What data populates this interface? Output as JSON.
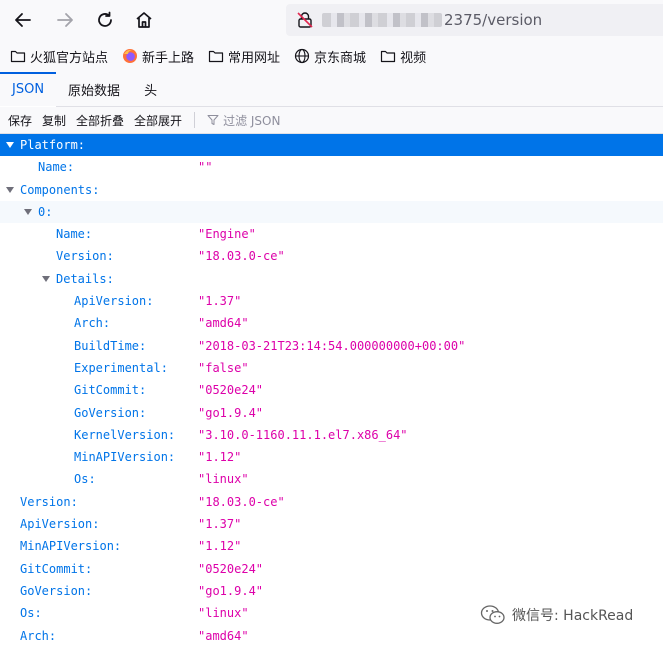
{
  "browser": {
    "url_visible": "2375/version",
    "bookmarks": [
      {
        "label": "火狐官方站点",
        "icon": "folder-icon"
      },
      {
        "label": "新手上路",
        "icon": "firefox-icon"
      },
      {
        "label": "常用网址",
        "icon": "folder-icon"
      },
      {
        "label": "京东商城",
        "icon": "globe-icon"
      },
      {
        "label": "视频",
        "icon": "folder-icon"
      }
    ]
  },
  "viewer": {
    "tabs": [
      "JSON",
      "原始数据",
      "头"
    ],
    "actions": [
      "保存",
      "复制",
      "全部折叠",
      "全部展开"
    ],
    "filter_placeholder": "过滤 JSON"
  },
  "rows": [
    {
      "key": "Platform:",
      "value": "",
      "depth": 0,
      "expandable": true,
      "selected": true
    },
    {
      "key": "Name:",
      "value": "\"\"",
      "depth": 1
    },
    {
      "key": "Components:",
      "value": "",
      "depth": 0,
      "expandable": true
    },
    {
      "key": "0:",
      "value": "",
      "depth": 1,
      "expandable": true
    },
    {
      "key": "Name:",
      "value": "\"Engine\"",
      "depth": 2
    },
    {
      "key": "Version:",
      "value": "\"18.03.0-ce\"",
      "depth": 2
    },
    {
      "key": "Details:",
      "value": "",
      "depth": 2,
      "expandable": true
    },
    {
      "key": "ApiVersion:",
      "value": "\"1.37\"",
      "depth": 3
    },
    {
      "key": "Arch:",
      "value": "\"amd64\"",
      "depth": 3
    },
    {
      "key": "BuildTime:",
      "value": "\"2018-03-21T23:14:54.000000000+00:00\"",
      "depth": 3
    },
    {
      "key": "Experimental:",
      "value": "\"false\"",
      "depth": 3
    },
    {
      "key": "GitCommit:",
      "value": "\"0520e24\"",
      "depth": 3
    },
    {
      "key": "GoVersion:",
      "value": "\"go1.9.4\"",
      "depth": 3
    },
    {
      "key": "KernelVersion:",
      "value": "\"3.10.0-1160.11.1.el7.x86_64\"",
      "depth": 3
    },
    {
      "key": "MinAPIVersion:",
      "value": "\"1.12\"",
      "depth": 3
    },
    {
      "key": "Os:",
      "value": "\"linux\"",
      "depth": 3
    },
    {
      "key": "Version:",
      "value": "\"18.03.0-ce\"",
      "depth": 0
    },
    {
      "key": "ApiVersion:",
      "value": "\"1.37\"",
      "depth": 0
    },
    {
      "key": "MinAPIVersion:",
      "value": "\"1.12\"",
      "depth": 0
    },
    {
      "key": "GitCommit:",
      "value": "\"0520e24\"",
      "depth": 0
    },
    {
      "key": "GoVersion:",
      "value": "\"go1.9.4\"",
      "depth": 0
    },
    {
      "key": "Os:",
      "value": "\"linux\"",
      "depth": 0
    },
    {
      "key": "Arch:",
      "value": "\"amd64\"",
      "depth": 0
    }
  ],
  "watermark": "微信号: HackRead",
  "colors": {
    "accent": "#0074e8",
    "string_value": "#dd00a9",
    "selected_row": "#0074e8"
  }
}
